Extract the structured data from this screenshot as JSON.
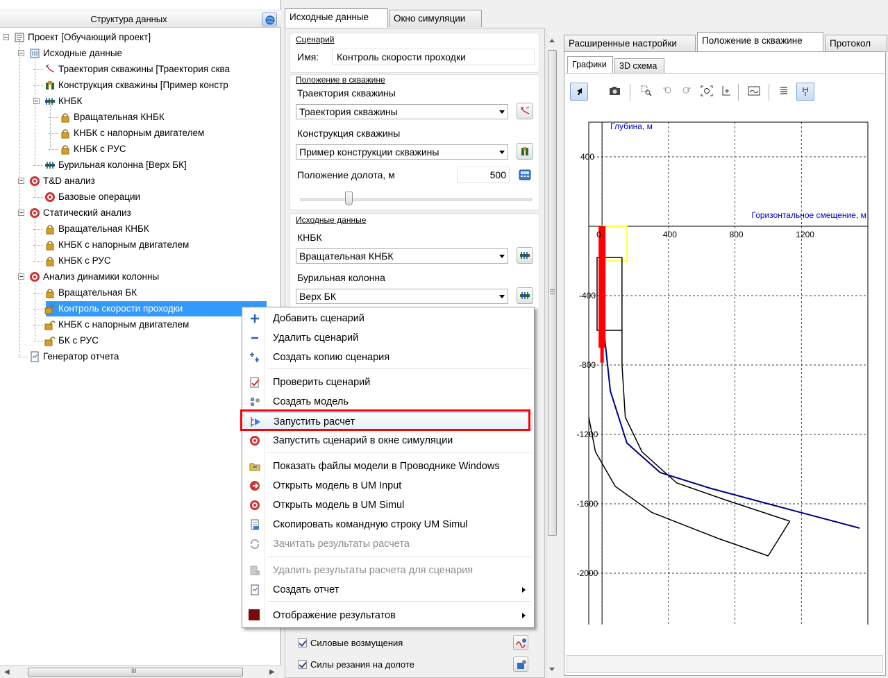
{
  "left_panel": {
    "header": "Структура данных",
    "tree": [
      {
        "label": "Проект [Обучающий проект]",
        "icon": "project-icon"
      },
      {
        "label": "Исходные данные",
        "icon": "input-data-icon"
      },
      {
        "label": "Траектория скважины [Траектория сква",
        "icon": "trajectory-icon"
      },
      {
        "label": "Конструкция скважины [Пример констр",
        "icon": "construction-icon"
      },
      {
        "label": "КНБК",
        "icon": "bha-icon"
      },
      {
        "label": "Вращательная КНБК",
        "icon": "lock-icon"
      },
      {
        "label": "КНБК с напорным двигателем",
        "icon": "lock-icon"
      },
      {
        "label": "КНБК с РУС",
        "icon": "lock-icon"
      },
      {
        "label": "Бурильная колонна [Верх БК]",
        "icon": "drill-string-icon"
      },
      {
        "label": "T&D анализ",
        "icon": "analysis-icon"
      },
      {
        "label": "Базовые операции",
        "icon": "analysis-icon"
      },
      {
        "label": "Статический анализ",
        "icon": "analysis-icon"
      },
      {
        "label": "Вращательная КНБК",
        "icon": "lock-icon"
      },
      {
        "label": "КНБК с напорным двигателем",
        "icon": "lock-icon"
      },
      {
        "label": "КНБК с РУС",
        "icon": "lock-icon"
      },
      {
        "label": "Анализ динамики колонны",
        "icon": "analysis-icon"
      },
      {
        "label": "Вращательная БК",
        "icon": "lock-icon"
      },
      {
        "label": "Контроль скорости проходки",
        "icon": "unlock-icon"
      },
      {
        "label": "КНБК с напорным двигателем",
        "icon": "unlock-icon"
      },
      {
        "label": "БК с РУС",
        "icon": "unlock-icon"
      },
      {
        "label": "Генератор отчета",
        "icon": "report-icon"
      }
    ],
    "scroll_grip": "III"
  },
  "middle_panel": {
    "tabs": [
      "Исходные данные",
      "Окно симуляции"
    ],
    "scenario_caption": "Сценарий",
    "name_label": "Имя:",
    "name_value": "Контроль скорости проходки",
    "position_caption": "Положение в скважине",
    "trajectory_label": "Траектория скважины",
    "trajectory_value": "Траектория скважины",
    "construction_label": "Конструкция скважины",
    "construction_value": "Пример конструкции скважины",
    "bit_position_label": "Положение долота, м",
    "bit_position_value": "500",
    "bit_position_fraction": 0.2,
    "source_caption": "Исходные данные",
    "bha_label": "КНБК",
    "bha_value": "Вращательная КНБК",
    "string_label": "Бурильная колонна",
    "string_value": "Верх БК",
    "check_forces": "Силовые возмущения",
    "check_cutting": "Силы резания на долоте"
  },
  "right_panel": {
    "tabs": [
      "Расширенные настройки",
      "Положение в скважине",
      "Протокол"
    ],
    "subtabs": [
      "Графики",
      "3D схема"
    ],
    "toolbar_icons": [
      "pointer-icon",
      "camera-icon",
      "zoom-rect-icon",
      "undo-zoom-icon",
      "redo-zoom-icon",
      "zoom-fit-icon",
      "axis-icon",
      "legend-icon",
      "list-icon",
      "pin-icon"
    ]
  },
  "chart_data": {
    "type": "line",
    "ylabel": "Глубина, м",
    "xlabel": "Горизонтальное смещение, м",
    "x_ticks": [
      "0",
      "400",
      "800",
      "1200"
    ],
    "y_ticks": [
      "400",
      "-400",
      "-800",
      "-1200",
      "-1600",
      "-2000"
    ],
    "xlim": [
      -80,
      1600
    ],
    "ylim": [
      -2400,
      600
    ],
    "grid": true,
    "series": [
      {
        "color": "#000080",
        "points": [
          [
            0,
            -500
          ],
          [
            50,
            -950
          ],
          [
            150,
            -1250
          ],
          [
            350,
            -1420
          ],
          [
            650,
            -1510
          ],
          [
            1000,
            -1600
          ],
          [
            1550,
            -1740
          ]
        ]
      }
    ],
    "colors": {
      "drill_string": "#ff0000",
      "outline": "#000000",
      "highlight_box": "#ffff00",
      "label": "#0000cc"
    }
  },
  "context_menu": {
    "items": [
      {
        "label": "Добавить сценарий",
        "icon": "plus-icon",
        "disabled": false,
        "submenu": false
      },
      {
        "label": "Удалить сценарий",
        "icon": "minus-icon",
        "disabled": false,
        "submenu": false
      },
      {
        "label": "Создать копию сценария",
        "icon": "copy-icon",
        "disabled": false,
        "submenu": false
      },
      {
        "label": "Проверить сценарий",
        "icon": "check-icon",
        "disabled": false,
        "submenu": false
      },
      {
        "label": "Создать модель",
        "icon": "model-icon",
        "disabled": false,
        "submenu": false
      },
      {
        "label": "Запустить расчет",
        "icon": "run-icon",
        "disabled": false,
        "submenu": false
      },
      {
        "label": "Запустить сценарий в окне симуляции",
        "icon": "simul-icon",
        "disabled": false,
        "submenu": false
      },
      {
        "label": "Показать файлы модели в Проводнике Windows",
        "icon": "folder-icon",
        "disabled": false,
        "submenu": false
      },
      {
        "label": "Открыть модель в UM Input",
        "icon": "um-input-icon",
        "disabled": false,
        "submenu": false
      },
      {
        "label": "Открыть модель в UM Simul",
        "icon": "um-simul-icon",
        "disabled": false,
        "submenu": false
      },
      {
        "label": "Скопировать командную строку UM Simul",
        "icon": "copy-cmd-icon",
        "disabled": false,
        "submenu": false
      },
      {
        "label": "Зачитать результаты расчета",
        "icon": "reload-icon",
        "disabled": true,
        "submenu": false
      },
      {
        "label": "Удалить результаты расчета для сценария",
        "icon": "delete-results-icon",
        "disabled": true,
        "submenu": false
      },
      {
        "label": "Создать отчет",
        "icon": "report-icon",
        "disabled": false,
        "submenu": true
      },
      {
        "label": "Отображение результатов",
        "icon": "results-icon",
        "disabled": false,
        "submenu": true
      }
    ]
  }
}
